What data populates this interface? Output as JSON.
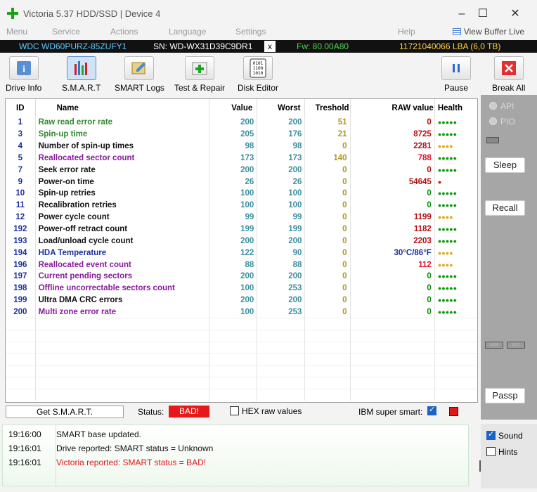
{
  "window": {
    "title": "Victoria 5.37 HDD/SSD | Device 4"
  },
  "menu": [
    "Menu",
    "Service",
    "Actions",
    "Language",
    "Settings",
    "Help"
  ],
  "view_buffer_label": "View Buffer Live",
  "drive": {
    "model": "WDC WD60PURZ-85ZUFY1",
    "serial": "SN: WD-WX31D39C9DR1",
    "close": "x",
    "firmware": "Fw: 80.00A80",
    "lba": "11721040066 LBA (6,0 TB)"
  },
  "toolbar": {
    "drive_info": "Drive Info",
    "smart": "S.M.A.R.T",
    "smart_logs": "SMART Logs",
    "test_repair": "Test & Repair",
    "disk_editor": "Disk Editor",
    "pause": "Pause",
    "break_all": "Break All"
  },
  "table": {
    "headers": {
      "id": "ID",
      "name": "Name",
      "value": "Value",
      "worst": "Worst",
      "treshold": "Treshold",
      "raw": "RAW value",
      "health": "Health"
    },
    "rows": [
      {
        "id": "1",
        "name": "Raw read error rate",
        "value": "200",
        "worst": "200",
        "tres": "51",
        "raw": "0",
        "health": "●●●●●",
        "name_color": "#2f8a2f",
        "raw_color": "#b01010",
        "health_color": "#0a9a0a"
      },
      {
        "id": "3",
        "name": "Spin-up time",
        "value": "205",
        "worst": "176",
        "tres": "21",
        "raw": "8725",
        "health": "●●●●●",
        "name_color": "#2f8a2f",
        "raw_color": "#b01010",
        "health_color": "#0a9a0a"
      },
      {
        "id": "4",
        "name": "Number of spin-up times",
        "value": "98",
        "worst": "98",
        "tres": "0",
        "raw": "2281",
        "health": "●●●●",
        "name_color": "#111111",
        "raw_color": "#b01010",
        "health_color": "#e0a810"
      },
      {
        "id": "5",
        "name": "Reallocated sector count",
        "value": "173",
        "worst": "173",
        "tres": "140",
        "raw": "788",
        "health": "●●●●●",
        "name_color": "#8a1aa0",
        "raw_color": "#e0102a",
        "health_color": "#0a9a0a"
      },
      {
        "id": "7",
        "name": "Seek error rate",
        "value": "200",
        "worst": "200",
        "tres": "0",
        "raw": "0",
        "health": "●●●●●",
        "name_color": "#111111",
        "raw_color": "#b01010",
        "health_color": "#0a9a0a"
      },
      {
        "id": "9",
        "name": "Power-on time",
        "value": "26",
        "worst": "26",
        "tres": "0",
        "raw": "54645",
        "health": "●",
        "name_color": "#111111",
        "raw_color": "#b01010",
        "health_color": "#d01010"
      },
      {
        "id": "10",
        "name": "Spin-up retries",
        "value": "100",
        "worst": "100",
        "tres": "0",
        "raw": "0",
        "health": "●●●●●",
        "name_color": "#111111",
        "raw_color": "#0a8a0a",
        "health_color": "#0a9a0a"
      },
      {
        "id": "11",
        "name": "Recalibration retries",
        "value": "100",
        "worst": "100",
        "tres": "0",
        "raw": "0",
        "health": "●●●●●",
        "name_color": "#111111",
        "raw_color": "#0a8a0a",
        "health_color": "#0a9a0a"
      },
      {
        "id": "12",
        "name": "Power cycle count",
        "value": "99",
        "worst": "99",
        "tres": "0",
        "raw": "1199",
        "health": "●●●●",
        "name_color": "#111111",
        "raw_color": "#b01010",
        "health_color": "#e0a810"
      },
      {
        "id": "192",
        "name": "Power-off retract count",
        "value": "199",
        "worst": "199",
        "tres": "0",
        "raw": "1182",
        "health": "●●●●●",
        "name_color": "#111111",
        "raw_color": "#b01010",
        "health_color": "#0a9a0a"
      },
      {
        "id": "193",
        "name": "Load/unload cycle count",
        "value": "200",
        "worst": "200",
        "tres": "0",
        "raw": "2203",
        "health": "●●●●●",
        "name_color": "#111111",
        "raw_color": "#b01010",
        "health_color": "#0a9a0a"
      },
      {
        "id": "194",
        "name": "HDA Temperature",
        "value": "122",
        "worst": "90",
        "tres": "0",
        "raw": "30°C/86°F",
        "health": "●●●●",
        "name_color": "#1a2f9c",
        "raw_color": "#1a2f9c",
        "health_color": "#e0a810"
      },
      {
        "id": "196",
        "name": "Reallocated event count",
        "value": "88",
        "worst": "88",
        "tres": "0",
        "raw": "112",
        "health": "●●●●",
        "name_color": "#8a1aa0",
        "raw_color": "#e0102a",
        "health_color": "#e0a810"
      },
      {
        "id": "197",
        "name": "Current pending sectors",
        "value": "200",
        "worst": "200",
        "tres": "0",
        "raw": "0",
        "health": "●●●●●",
        "name_color": "#8a1aa0",
        "raw_color": "#0a8a0a",
        "health_color": "#0a9a0a"
      },
      {
        "id": "198",
        "name": "Offline uncorrectable sectors count",
        "value": "100",
        "worst": "253",
        "tres": "0",
        "raw": "0",
        "health": "●●●●●",
        "name_color": "#8a1aa0",
        "raw_color": "#0a8a0a",
        "health_color": "#0a9a0a"
      },
      {
        "id": "199",
        "name": "Ultra DMA CRC errors",
        "value": "200",
        "worst": "200",
        "tres": "0",
        "raw": "0",
        "health": "●●●●●",
        "name_color": "#111111",
        "raw_color": "#0a8a0a",
        "health_color": "#0a9a0a"
      },
      {
        "id": "200",
        "name": "Multi zone error rate",
        "value": "100",
        "worst": "253",
        "tres": "0",
        "raw": "0",
        "health": "●●●●●",
        "name_color": "#8a1aa0",
        "raw_color": "#0a8a0a",
        "health_color": "#0a9a0a"
      }
    ]
  },
  "sidebar": {
    "api": "API",
    "pio": "PIO",
    "sleep": "Sleep",
    "recall": "Recall",
    "wr": "WR",
    "rd": "RD",
    "passp": "Passp"
  },
  "statusbar": {
    "get_smart": "Get S.M.A.R.T.",
    "status_label": "Status:",
    "status_value": "BAD!",
    "hex_raw": "HEX raw values",
    "ibm_smart": "IBM super smart:"
  },
  "log": [
    {
      "time": "19:16:00",
      "msg": "SMART base updated.",
      "color": "#111111"
    },
    {
      "time": "19:16:01",
      "msg": "Drive reported: SMART status = Unknown",
      "color": "#111111"
    },
    {
      "time": "19:16:01",
      "msg": "Victoria reported: SMART status = BAD!",
      "color": "#e01818"
    }
  ],
  "options": {
    "sound": "Sound",
    "hints": "Hints"
  }
}
